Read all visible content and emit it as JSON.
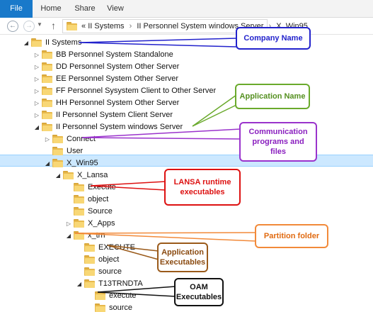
{
  "ribbon": {
    "tabs": [
      "File",
      "Home",
      "Share",
      "View"
    ]
  },
  "address": {
    "crumbs": [
      "II Systems",
      "II Personnel System windows Server",
      "X_Win95"
    ],
    "lead": "«"
  },
  "tree": [
    {
      "label": "II Systems",
      "indent": 0,
      "state": "open"
    },
    {
      "label": "BB Personnel System Standalone",
      "indent": 1,
      "state": "closed"
    },
    {
      "label": "DD Personnel System Other Server",
      "indent": 1,
      "state": "closed"
    },
    {
      "label": "EE Personnel System Other Server",
      "indent": 1,
      "state": "closed"
    },
    {
      "label": "FF Personnel Sysystem Client to Other Server",
      "indent": 1,
      "state": "closed"
    },
    {
      "label": "HH Personnel System Other Server",
      "indent": 1,
      "state": "closed"
    },
    {
      "label": "II Personnel System Client Server",
      "indent": 1,
      "state": "closed"
    },
    {
      "label": "II Personnel System windows Server",
      "indent": 1,
      "state": "open"
    },
    {
      "label": "Connect",
      "indent": 2,
      "state": "closed"
    },
    {
      "label": "User",
      "indent": 2,
      "state": "none"
    },
    {
      "label": "X_Win95",
      "indent": 2,
      "state": "open",
      "selected": true
    },
    {
      "label": "X_Lansa",
      "indent": 3,
      "state": "open"
    },
    {
      "label": "Execute",
      "indent": 4,
      "state": "none"
    },
    {
      "label": "object",
      "indent": 4,
      "state": "none"
    },
    {
      "label": "Source",
      "indent": 4,
      "state": "none"
    },
    {
      "label": "X_Apps",
      "indent": 4,
      "state": "closed"
    },
    {
      "label": "x_trn",
      "indent": 4,
      "state": "open"
    },
    {
      "label": "EXECUTE",
      "indent": 5,
      "state": "none"
    },
    {
      "label": "object",
      "indent": 5,
      "state": "none"
    },
    {
      "label": "source",
      "indent": 5,
      "state": "none"
    },
    {
      "label": "T13TRNDTA",
      "indent": 5,
      "state": "open"
    },
    {
      "label": "execute",
      "indent": 6,
      "state": "none"
    },
    {
      "label": "source",
      "indent": 6,
      "state": "none"
    }
  ],
  "callouts": {
    "company": "Company Name",
    "application": "Application Name",
    "communication": "Communication programs and files",
    "lansa": "LANSA runtime executables",
    "partition": "Partition folder",
    "app_exec": "Application Executables",
    "oam": "OAM Executables"
  },
  "colors": {
    "company": "#2222cc",
    "application": "#6aaa2c",
    "communication": "#9a33cc",
    "lansa": "#dd1111",
    "partition": "#f28a3a",
    "app_exec": "#9a5a1a",
    "oam": "#111111",
    "selection": "#cce8ff"
  }
}
